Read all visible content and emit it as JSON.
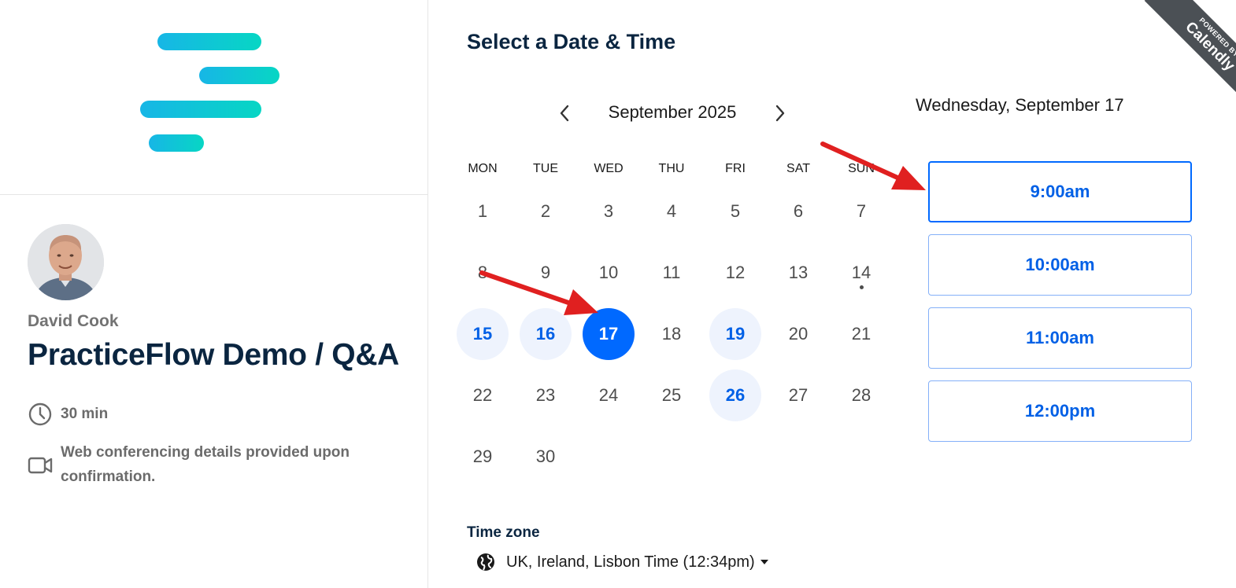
{
  "host": {
    "name": "David Cook",
    "event_title": "PracticeFlow Demo / Q&A",
    "duration": "30 min",
    "conferencing": "Web conferencing details provided upon confirmation.",
    "conferencing_line1": "Web conferencing details provided upon",
    "conferencing_line2": "confirmation."
  },
  "scheduler": {
    "heading": "Select a Date & Time",
    "month_label": "September 2025",
    "weekdays": [
      "MON",
      "TUE",
      "WED",
      "THU",
      "FRI",
      "SAT",
      "SUN"
    ],
    "days": [
      "1",
      "2",
      "3",
      "4",
      "5",
      "6",
      "7",
      "8",
      "9",
      "10",
      "11",
      "12",
      "13",
      "14",
      "15",
      "16",
      "17",
      "18",
      "19",
      "20",
      "21",
      "22",
      "23",
      "24",
      "25",
      "26",
      "27",
      "28",
      "29",
      "30"
    ],
    "available_days": [
      "15",
      "16",
      "19",
      "26"
    ],
    "selected_day": "17",
    "today_day": "14",
    "timezone_label": "Time zone",
    "timezone_value": "UK, Ireland, Lisbon Time (12:34pm)"
  },
  "times": {
    "selected_date": "Wednesday, September 17",
    "slots": [
      "9:00am",
      "10:00am",
      "11:00am",
      "12:00pm"
    ]
  },
  "badge": {
    "powered_by": "POWERED BY",
    "brand": "Calendly"
  },
  "colors": {
    "accent": "#0069ff",
    "available_bg": "#eef3fd",
    "heading": "#0a2540",
    "annotation_arrow": "#e02020"
  }
}
